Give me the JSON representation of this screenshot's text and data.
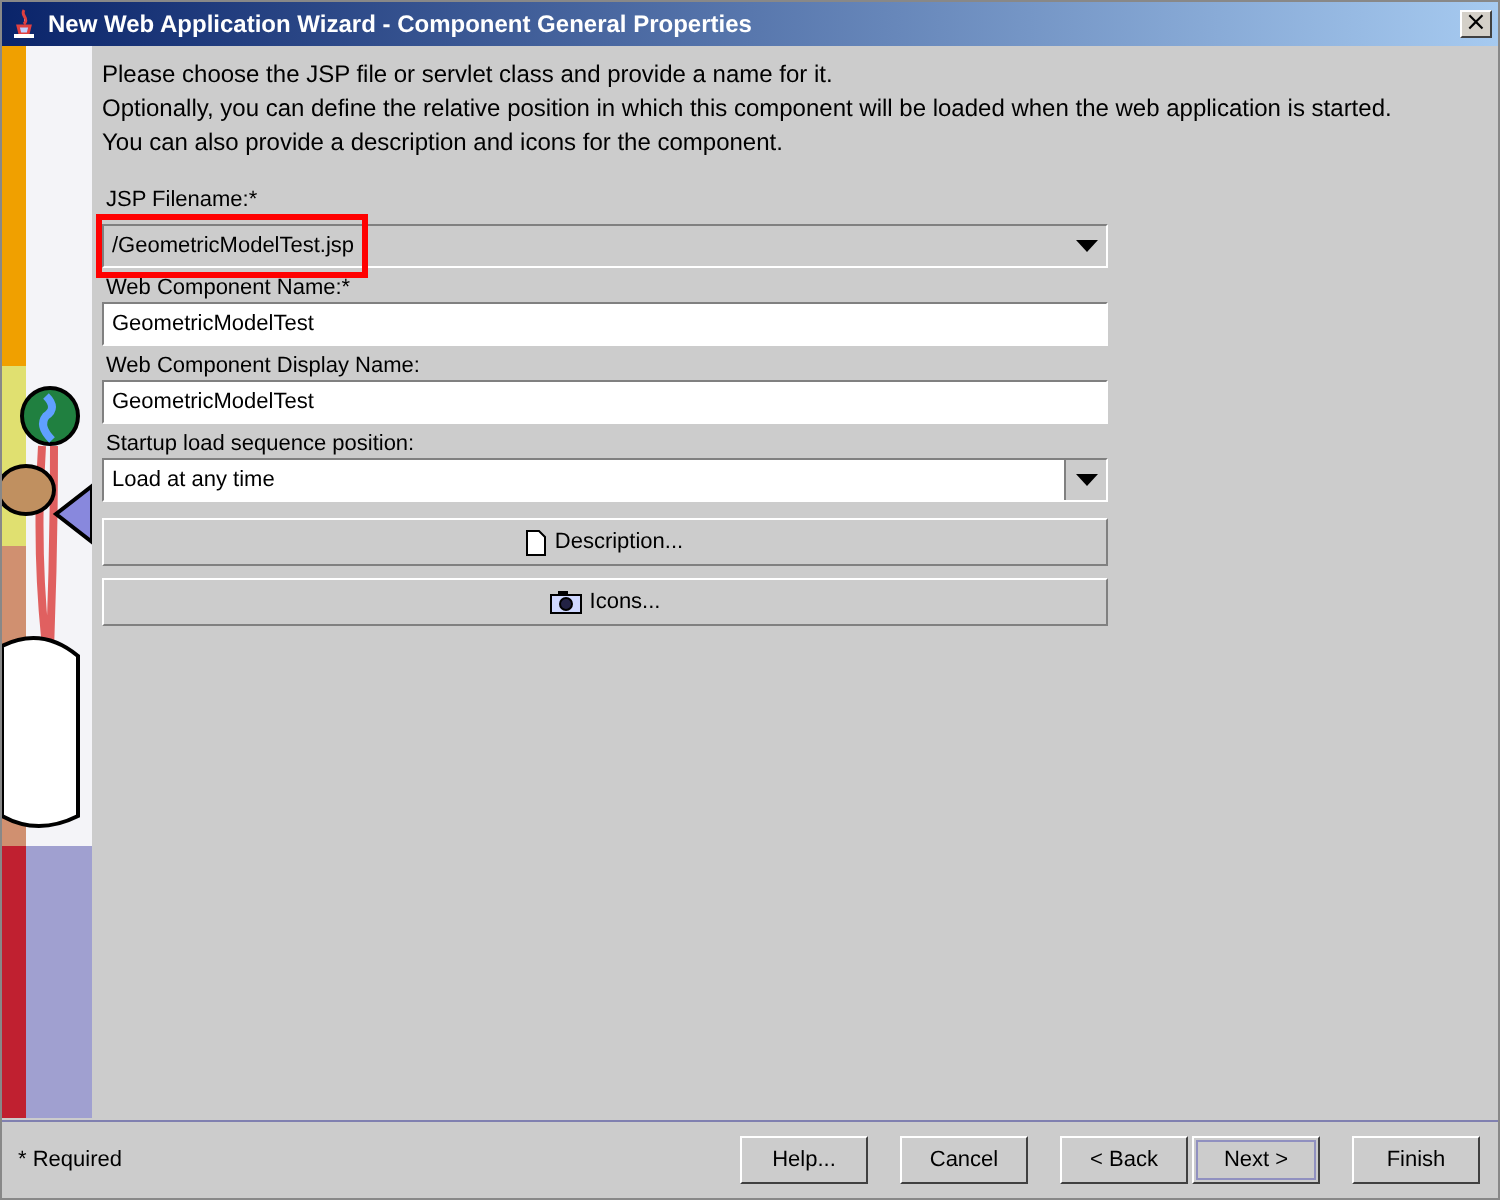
{
  "window": {
    "title": "New Web Application Wizard - Component General Properties",
    "close": "×"
  },
  "instructions": [
    "Please choose the JSP file or servlet class and provide a name for it.",
    "Optionally, you can define the relative position in which this component will be loaded when the web application is started.",
    "You can also provide a description and icons for the component."
  ],
  "fields": [
    {
      "kind": "combo",
      "label": "JSP Filename:*",
      "value": "/GeometricModelTest.jsp",
      "editable": false,
      "highlighted": true
    },
    {
      "kind": "text",
      "label": "Web Component Name:*",
      "value": "GeometricModelTest"
    },
    {
      "kind": "text",
      "label": "Web Component Display Name:",
      "value": "GeometricModelTest"
    },
    {
      "kind": "combo",
      "label": "Startup load sequence position:",
      "value": "Load at any time",
      "editable": true,
      "highlighted": false
    }
  ],
  "actions": [
    {
      "kind": "document",
      "label": "Description..."
    },
    {
      "kind": "camera",
      "label": "Icons..."
    }
  ],
  "footer": {
    "note": "* Required",
    "buttons": [
      {
        "label": "Help...",
        "focused": false
      },
      {
        "label": "Cancel",
        "focused": false
      },
      {
        "label": "< Back",
        "focused": false
      },
      {
        "label": "Next >",
        "focused": true
      },
      {
        "label": "Finish",
        "focused": false
      }
    ]
  }
}
